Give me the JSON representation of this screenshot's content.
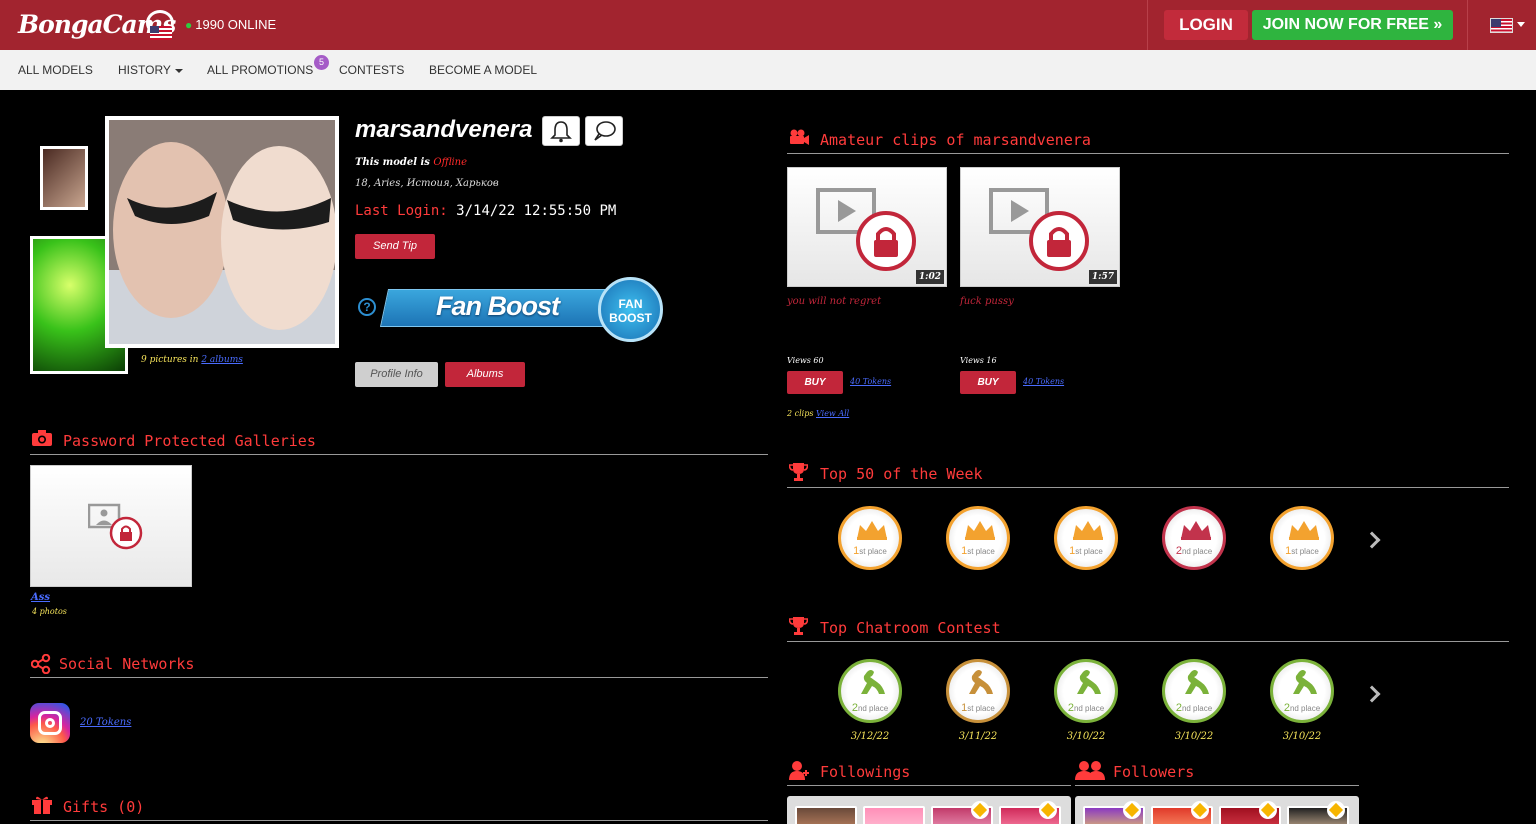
{
  "header": {
    "logo_text": "BongaCams",
    "online_count": "1990 ONLINE",
    "login_label": "LOGIN",
    "join_label": "JOIN NOW FOR FREE »",
    "language_flag": "us-flag-icon"
  },
  "nav": {
    "items": [
      "ALL MODELS",
      "HISTORY",
      "ALL PROMOTIONS",
      "CONTESTS",
      "BECOME A MODEL"
    ],
    "promotions_badge": "5"
  },
  "profile": {
    "name": "marsandvenera",
    "status_prefix": "This model is ",
    "status": "Offline",
    "info": "18, Aries, Истоия, Харьков",
    "last_login_label": "Last Login:",
    "last_login_value": "3/14/22 12:55:50 PM",
    "send_tip_label": "Send Tip",
    "pictures_caption": "9 pictures in ",
    "albums_link": "2 albums",
    "profile_info_label": "Profile Info",
    "albums_label": "Albums",
    "fanboost_text": "Fan Boost",
    "fanboost_badge": "FAN BOOST",
    "help_label": "?"
  },
  "galleries": {
    "heading": "Password Protected Galleries",
    "items": [
      {
        "title": "Ass",
        "count": "4 photos"
      }
    ]
  },
  "social": {
    "heading": "Social Networks",
    "instagram_price": "20 Tokens"
  },
  "gifts": {
    "heading": "Gifts (0)"
  },
  "clips": {
    "heading": "Amateur clips of marsandvenera",
    "items": [
      {
        "duration": "1:02",
        "title": "you will not regret",
        "views": "Views 60",
        "buy_label": "BUY",
        "price": "40 Tokens"
      },
      {
        "duration": "1:57",
        "title": "fuck pussy",
        "views": "Views 16",
        "buy_label": "BUY",
        "price": "40 Tokens"
      }
    ],
    "count_text": "2 clips ",
    "view_all": "View All"
  },
  "top50": {
    "heading": "Top 50 of the Week",
    "medals": [
      {
        "place_num": "1",
        "place_suffix": "st place",
        "color": "#f3a22f"
      },
      {
        "place_num": "1",
        "place_suffix": "st place",
        "color": "#f3a22f"
      },
      {
        "place_num": "1",
        "place_suffix": "st place",
        "color": "#f3a22f"
      },
      {
        "place_num": "2",
        "place_suffix": "nd place",
        "color": "#c2334c"
      },
      {
        "place_num": "1",
        "place_suffix": "st place",
        "color": "#f3a22f"
      }
    ]
  },
  "chatroom": {
    "heading": "Top Chatroom Contest",
    "medals": [
      {
        "place_num": "2",
        "place_suffix": "nd place",
        "date": "3/12/22",
        "color": "#7bb23a"
      },
      {
        "place_num": "1",
        "place_suffix": "st place",
        "date": "3/11/22",
        "color": "#c7903a"
      },
      {
        "place_num": "2",
        "place_suffix": "nd place",
        "date": "3/10/22",
        "color": "#7bb23a"
      },
      {
        "place_num": "2",
        "place_suffix": "nd place",
        "date": "3/10/22",
        "color": "#7bb23a"
      },
      {
        "place_num": "2",
        "place_suffix": "nd place",
        "date": "3/10/22",
        "color": "#7bb23a"
      }
    ]
  },
  "followings": {
    "heading": "Followings"
  },
  "followers": {
    "heading": "Followers"
  },
  "colors": {
    "brand": "#a2242f",
    "accent_red": "#ff3b3b",
    "join_green": "#2fb43f"
  }
}
